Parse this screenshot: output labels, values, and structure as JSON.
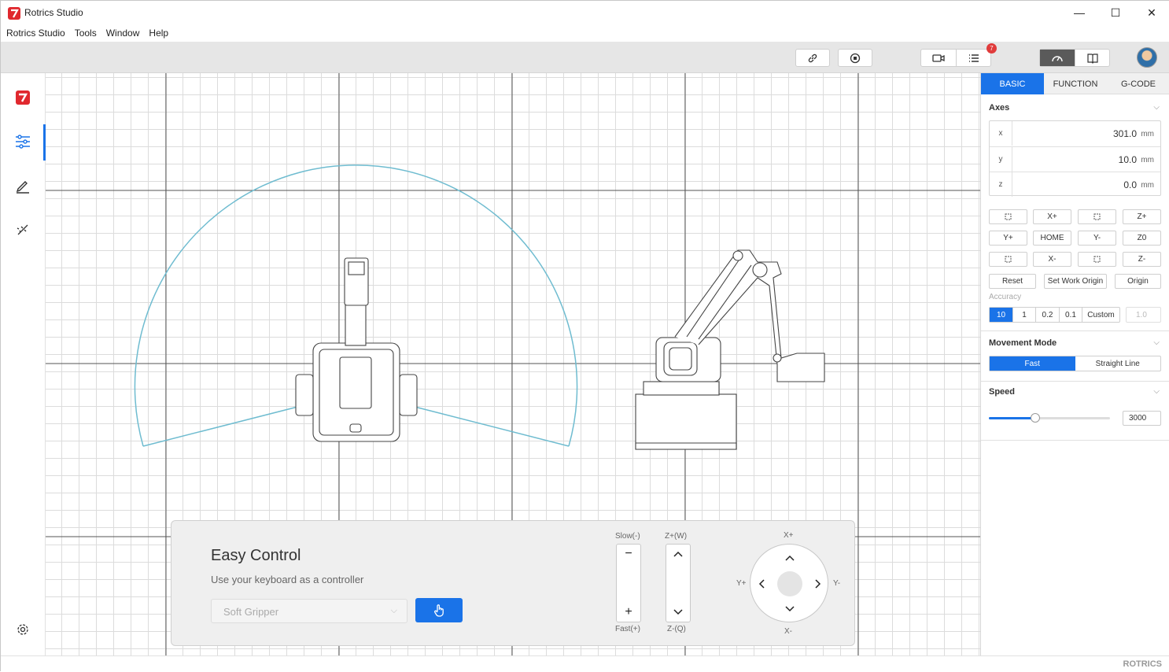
{
  "window": {
    "title": "Rotrics Studio",
    "minimize": "—",
    "maximize": "☐",
    "close": "✕"
  },
  "menu": [
    "Rotrics Studio",
    "Tools",
    "Window",
    "Help"
  ],
  "toolbar": {
    "notification_count": "7"
  },
  "sidebar": {
    "items": [
      "rotrics-logo",
      "adjust-sliders",
      "pen-draw",
      "laser"
    ]
  },
  "easy_control": {
    "title": "Easy Control",
    "subtitle": "Use your keyboard as a controller",
    "end_effector": "Soft Gripper",
    "slow_label": "Slow(-)",
    "fast_label": "Fast(+)",
    "minus": "−",
    "plus": "+",
    "zup_label": "Z+(W)",
    "zdown_label": "Z-(Q)",
    "xplus": "X+",
    "xminus": "X-",
    "yplus": "Y+",
    "yminus": "Y-"
  },
  "panel": {
    "tabs": [
      "BASIC",
      "FUNCTION",
      "G-CODE"
    ],
    "active_tab": 0,
    "axes_title": "Axes",
    "axes": [
      {
        "name": "x",
        "value": "301.0",
        "unit": "mm"
      },
      {
        "name": "y",
        "value": "10.0",
        "unit": "mm"
      },
      {
        "name": "z",
        "value": "0.0",
        "unit": "mm"
      }
    ],
    "jog": {
      "x_plus": "X+",
      "z_plus": "Z+",
      "y_plus": "Y+",
      "home": "HOME",
      "y_minus": "Y-",
      "z0": "Z0",
      "x_minus": "X-",
      "z_minus": "Z-"
    },
    "reset": "Reset",
    "set_work_origin": "Set Work Origin",
    "origin": "Origin",
    "accuracy_label": "Accuracy",
    "accuracy_options": [
      "10",
      "1",
      "0.2",
      "0.1",
      "Custom"
    ],
    "accuracy_custom_value": "1.0",
    "movement_title": "Movement Mode",
    "movement_options": [
      "Fast",
      "Straight Line"
    ],
    "speed_title": "Speed",
    "speed_value": "3000",
    "speed_fraction": 0.38
  },
  "status": {
    "brand": "ROTRICS"
  },
  "colors": {
    "accent": "#1a73e8",
    "workspace_arc": "#6fbcd0"
  }
}
